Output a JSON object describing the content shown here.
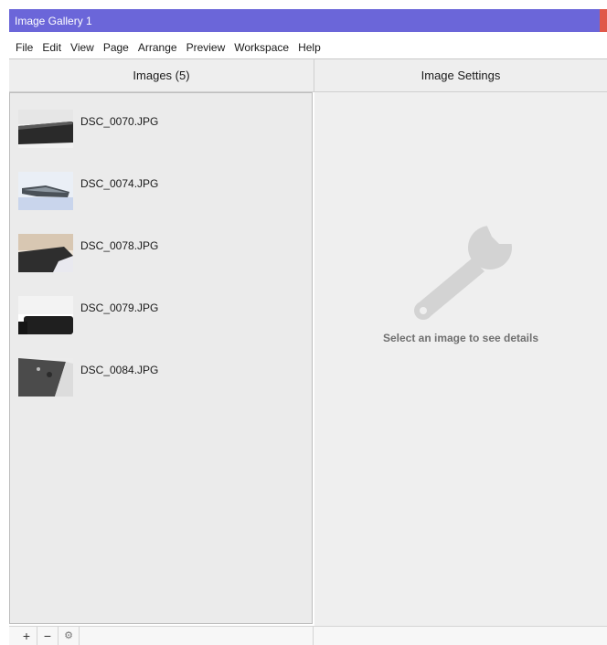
{
  "window": {
    "title": "Image Gallery 1"
  },
  "menu": [
    "File",
    "Edit",
    "View",
    "Page",
    "Arrange",
    "Preview",
    "Workspace",
    "Help"
  ],
  "images_panel": {
    "header": "Images (5)",
    "items": [
      {
        "name": "DSC_0070.JPG"
      },
      {
        "name": "DSC_0074.JPG"
      },
      {
        "name": "DSC_0078.JPG"
      },
      {
        "name": "DSC_0079.JPG"
      },
      {
        "name": "DSC_0084.JPG"
      }
    ]
  },
  "settings_panel": {
    "header": "Image Settings",
    "placeholder": "Select an image to see details"
  },
  "toolbar": {
    "add_label": "+",
    "remove_label": "−",
    "options_label": "⚙"
  },
  "colors": {
    "titlebar": "#6b66d9",
    "close": "#e0584a",
    "panel_bg": "#ebebeb",
    "wrench": "#d3d3d3"
  }
}
